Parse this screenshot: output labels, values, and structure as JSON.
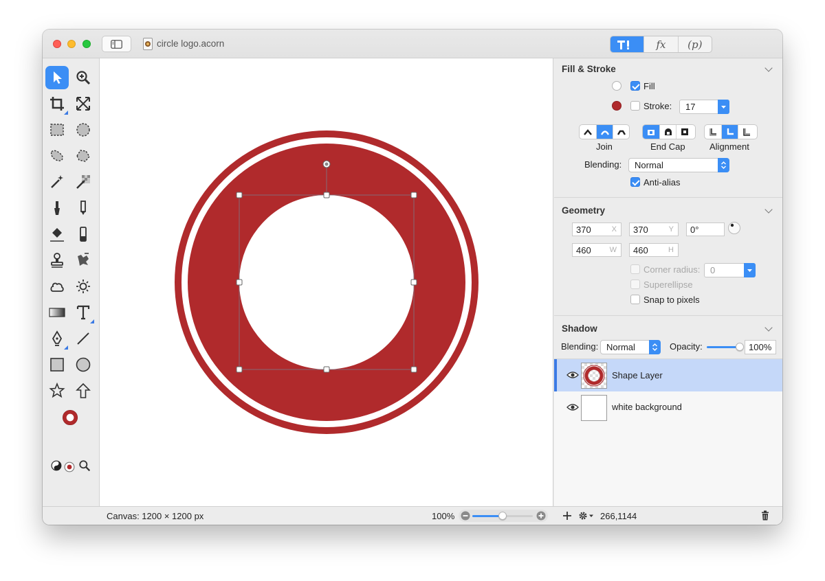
{
  "window": {
    "document_title": "circle logo.acorn",
    "inspector_tabs": [
      "tools-icon",
      "fx",
      "(p)"
    ],
    "inspector_tab_fx_label": "fx",
    "inspector_tab_p_label": "(p)"
  },
  "fill_stroke": {
    "title": "Fill & Stroke",
    "fill_label": "Fill",
    "fill_checked": true,
    "stroke_label": "Stroke:",
    "stroke_checked": false,
    "stroke_width": "17",
    "fill_color": "#ffffff",
    "stroke_color": "#b02a2c",
    "join_label": "Join",
    "end_cap_label": "End Cap",
    "alignment_label": "Alignment",
    "blending_label": "Blending:",
    "blending_value": "Normal",
    "antialias_label": "Anti-alias",
    "antialias_checked": true
  },
  "geometry": {
    "title": "Geometry",
    "x_value": "370",
    "x_suffix": "X",
    "y_value": "370",
    "y_suffix": "Y",
    "rotation_value": "0°",
    "w_value": "460",
    "w_suffix": "W",
    "h_value": "460",
    "h_suffix": "H",
    "corner_radius_label": "Corner radius:",
    "corner_radius_value": "0",
    "superellipse_label": "Superellipse",
    "snap_label": "Snap to pixels"
  },
  "shadow": {
    "title": "Shadow",
    "blending_label": "Blending:",
    "blending_value": "Normal",
    "opacity_label": "Opacity:",
    "opacity_value": "100%",
    "opacity_fraction": 1.0
  },
  "layers": [
    {
      "name": "Shape Layer",
      "selected": true
    },
    {
      "name": "white background",
      "selected": false
    }
  ],
  "status": {
    "canvas_size": "Canvas: 1200 × 1200 px",
    "zoom": "100%",
    "zoom_fraction": 0.5,
    "coordinates": "266,1144"
  },
  "colors": {
    "accent": "#3b8ef5",
    "logo_red": "#b02a2c"
  }
}
